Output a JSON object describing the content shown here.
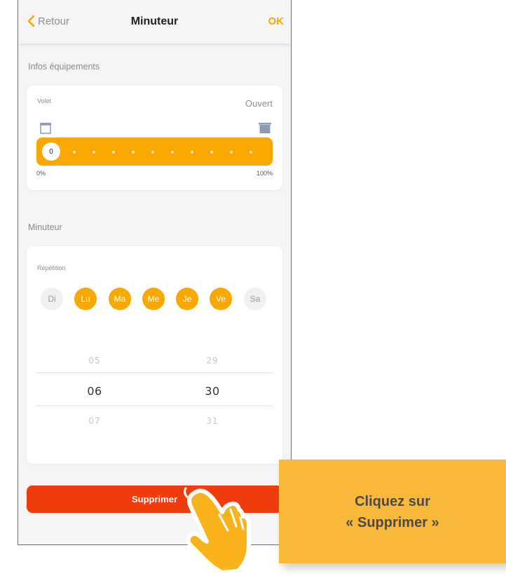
{
  "header": {
    "back_label": "Retour",
    "title": "Minuteur",
    "ok_label": "OK"
  },
  "equipment": {
    "section_label": "Infos équipements",
    "device_label": "Volet",
    "state": "Ouvert",
    "slider": {
      "value": "0",
      "min_label": "0%",
      "max_label": "100%",
      "fraction": 0
    }
  },
  "timer": {
    "section_label": "Minuteur",
    "repeat_label": "Répétition",
    "days": [
      {
        "label": "Di",
        "active": false
      },
      {
        "label": "Lu",
        "active": true
      },
      {
        "label": "Ma",
        "active": true
      },
      {
        "label": "Me",
        "active": true
      },
      {
        "label": "Je",
        "active": true
      },
      {
        "label": "Ve",
        "active": true
      },
      {
        "label": "Sa",
        "active": false
      }
    ],
    "hours": {
      "prev": "05",
      "selected": "06",
      "next": "07"
    },
    "minutes": {
      "prev": "29",
      "selected": "30",
      "next": "31"
    }
  },
  "delete_label": "Supprimer",
  "callout": {
    "line1": "Cliquez sur",
    "line2": "« Supprimer »"
  },
  "colors": {
    "accent": "#f8a800",
    "danger": "#f03d10",
    "callout": "#f8b93a"
  }
}
